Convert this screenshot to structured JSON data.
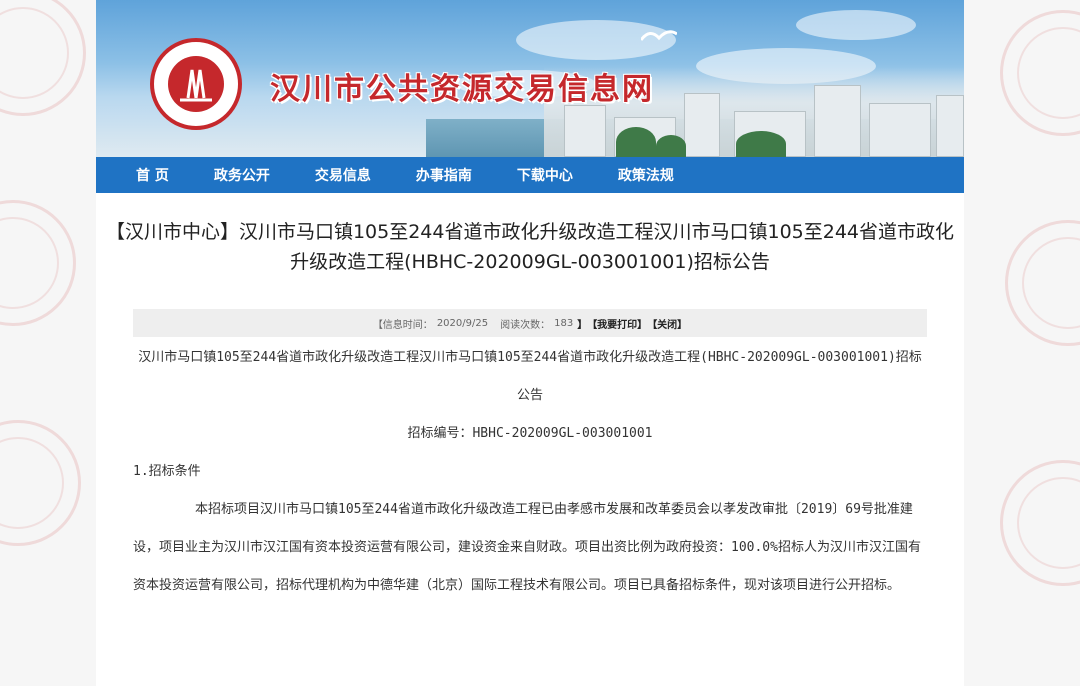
{
  "header": {
    "site_title": "汉川市公共资源交易信息网",
    "logo_icon": "government-resources-seal-icon"
  },
  "nav": {
    "items": [
      {
        "label": "首 页"
      },
      {
        "label": "政务公开"
      },
      {
        "label": "交易信息"
      },
      {
        "label": "办事指南"
      },
      {
        "label": "下载中心"
      },
      {
        "label": "政策法规"
      }
    ]
  },
  "article": {
    "title": "【汉川市中心】汉川市马口镇105至244省道市政化升级改造工程汉川市马口镇105至244省道市政化升级改造工程(HBHC-202009GL-003001001)招标公告",
    "info": {
      "date_label": "【信息时间：",
      "date_value": "2020/9/25",
      "views_label": "阅读次数：",
      "views_value": "183",
      "close_bracket": "】",
      "print_label": "【我要打印】",
      "close_label": "【关闭】"
    },
    "body_title": "汉川市马口镇105至244省道市政化升级改造工程汉川市马口镇105至244省道市政化升级改造工程(HBHC-202009GL-003001001)招标公告",
    "tender_no": "招标编号：HBHC-202009GL-003001001",
    "section1_heading": "1.招标条件",
    "section1_text": "本招标项目汉川市马口镇105至244省道市政化升级改造工程已由孝感市发展和改革委员会以孝发改审批〔2019〕69号批准建设，项目业主为汉川市汉江国有资本投资运营有限公司，建设资金来自财政。项目出资比例为政府投资：100.0%招标人为汉川市汉江国有资本投资运营有限公司，招标代理机构为中德华建（北京）国际工程技术有限公司。项目已具备招标条件，现对该项目进行公开招标。"
  },
  "colors": {
    "nav_blue": "#1f73c4",
    "title_red": "#c5282c"
  }
}
